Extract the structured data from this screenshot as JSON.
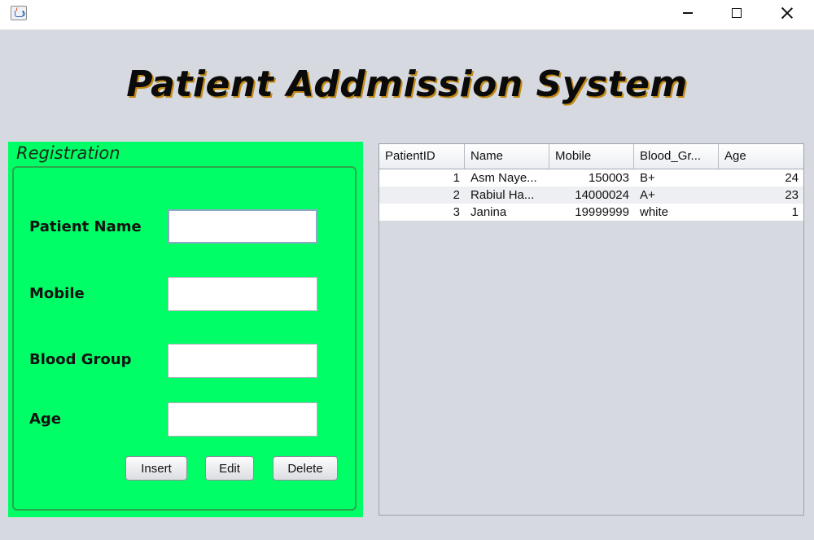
{
  "window": {
    "controls": {
      "minimize": "—",
      "maximize": "☐",
      "close": "✕"
    }
  },
  "header": {
    "title": "Patient Addmission System"
  },
  "registration": {
    "title": "Registration",
    "fields": [
      {
        "label": "Patient Name",
        "value": ""
      },
      {
        "label": "Mobile",
        "value": ""
      },
      {
        "label": "Blood Group",
        "value": ""
      },
      {
        "label": "Age",
        "value": ""
      }
    ],
    "buttons": {
      "insert": "Insert",
      "edit": "Edit",
      "delete": "Delete"
    }
  },
  "table": {
    "columns": [
      "PatientID",
      "Name",
      "Mobile",
      "Blood_Gr...",
      "Age"
    ],
    "rows": [
      [
        "1",
        "Asm Naye...",
        "150003",
        "B+",
        "24"
      ],
      [
        "2",
        "Rabiul Ha...",
        "14000024",
        "A+",
        "23"
      ],
      [
        "3",
        "Janina",
        "19999999",
        "white",
        "1"
      ]
    ]
  },
  "colors": {
    "panel": "#00ff66",
    "background": "#d6d9e0",
    "title_shadow": "#c28a12"
  }
}
